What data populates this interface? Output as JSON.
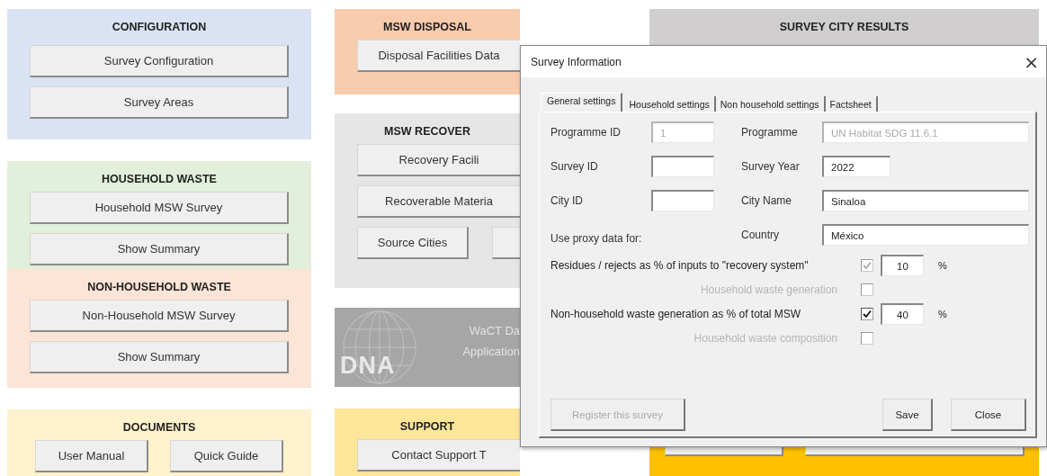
{
  "dashboard": {
    "columns": [
      {
        "panels": [
          {
            "kind": "section",
            "title": "CONFIGURATION",
            "color": "#dae3f3",
            "rows": [
              [
                {
                  "label": "Survey Configuration"
                }
              ],
              [
                {
                  "label": "Survey Areas"
                }
              ]
            ]
          },
          {
            "kind": "section",
            "title": "HOUSEHOLD WASTE",
            "color": "#e2efda",
            "rows": [
              [
                {
                  "label": "Household MSW Survey"
                }
              ],
              [
                {
                  "label": "Show Summary"
                }
              ]
            ]
          },
          {
            "kind": "joined-section",
            "title": "NON-HOUSEHOLD WASTE",
            "color": "#fce4d6",
            "rows": [
              [
                {
                  "label": "Non-Household MSW Survey"
                }
              ],
              [
                {
                  "label": "Show Summary"
                }
              ]
            ]
          },
          {
            "kind": "section",
            "title": "DOCUMENTS",
            "color": "#fff2cc",
            "rows": [
              [
                {
                  "label": "User Manual"
                },
                {
                  "label": "Quick Guide"
                }
              ]
            ]
          }
        ]
      },
      {
        "panels": [
          {
            "kind": "section",
            "title": "MSW DISPOSAL",
            "color": "#f8cbad",
            "rows": [
              [
                {
                  "label": "Disposal Facilities Data"
                }
              ]
            ]
          },
          {
            "kind": "section",
            "title": "MSW RECOVER",
            "color": "#e7e6e6",
            "rows": [
              [
                {
                  "label": "Recovery Facili"
                }
              ],
              [
                {
                  "label": "Recoverable Materia"
                }
              ],
              [
                {
                  "label": "Source Cities"
                },
                {
                  "kind": "blank"
                }
              ]
            ]
          },
          {
            "kind": "banner",
            "color": "#a6a6a6",
            "logo_text": "DNA",
            "lines": [
              "WaCT Da",
              "Application"
            ]
          },
          {
            "kind": "section",
            "title": "SUPPORT",
            "color": "#ffe699",
            "rows": [
              [
                {
                  "label": "Contact Support T"
                }
              ]
            ]
          }
        ]
      },
      {
        "panels": [
          {
            "kind": "section",
            "title": "SURVEY CITY RESULTS",
            "color": "#d0cece"
          },
          {
            "kind": "section",
            "color": "#ffc000",
            "rows": [
              [
                {
                  "kind": "blank"
                },
                {
                  "kind": "blank"
                }
              ]
            ]
          }
        ]
      }
    ]
  },
  "dialog": {
    "title": "Survey Information",
    "close": "×",
    "tabs": [
      {
        "label": "General settings",
        "selected": true
      },
      {
        "label": "Household settings",
        "selected": false
      },
      {
        "label": "Non household settings",
        "selected": false
      },
      {
        "label": "Factsheet",
        "selected": false
      }
    ],
    "fields": [
      {
        "kind": "short",
        "label": "Programme ID",
        "value": "1",
        "disabled": true
      },
      {
        "kind": "long",
        "label": "Programme",
        "value": "UN Habitat SDG 11.6.1",
        "disabled": true
      },
      {
        "kind": "short",
        "label": "Survey ID",
        "disabled": false
      },
      {
        "kind": "medium",
        "label": "Survey Year",
        "value": "2022",
        "disabled": false
      },
      {
        "kind": "short",
        "label": "City ID",
        "disabled": false
      },
      {
        "kind": "long",
        "label": "City Name",
        "value": "Sinaloa",
        "disabled": false
      },
      {
        "kind": "note",
        "label": "Use proxy data for:"
      },
      {
        "kind": "long",
        "label": "Country",
        "value": "México",
        "disabled": false
      }
    ],
    "proxy_options": [
      {
        "kind": "percent",
        "label": "Residues / rejects as % of inputs to \"recovery system\"",
        "checked": true,
        "disabled": true,
        "value": "10",
        "unit": "%"
      },
      {
        "kind": "option",
        "label": "Household waste generation",
        "checked": false,
        "disabled": true
      },
      {
        "kind": "percent",
        "label": "Non-household waste generation as % of total MSW",
        "checked": true,
        "disabled": false,
        "value": "40",
        "unit": "%"
      },
      {
        "kind": "option",
        "label": "Household waste composition",
        "checked": false,
        "disabled": true
      }
    ],
    "buttons": [
      {
        "label": "Register this survey",
        "disabled": true,
        "kind": "left"
      },
      {
        "label": "Save",
        "disabled": false,
        "kind": "right"
      },
      {
        "label": "Close",
        "disabled": false,
        "kind": "right"
      }
    ]
  }
}
